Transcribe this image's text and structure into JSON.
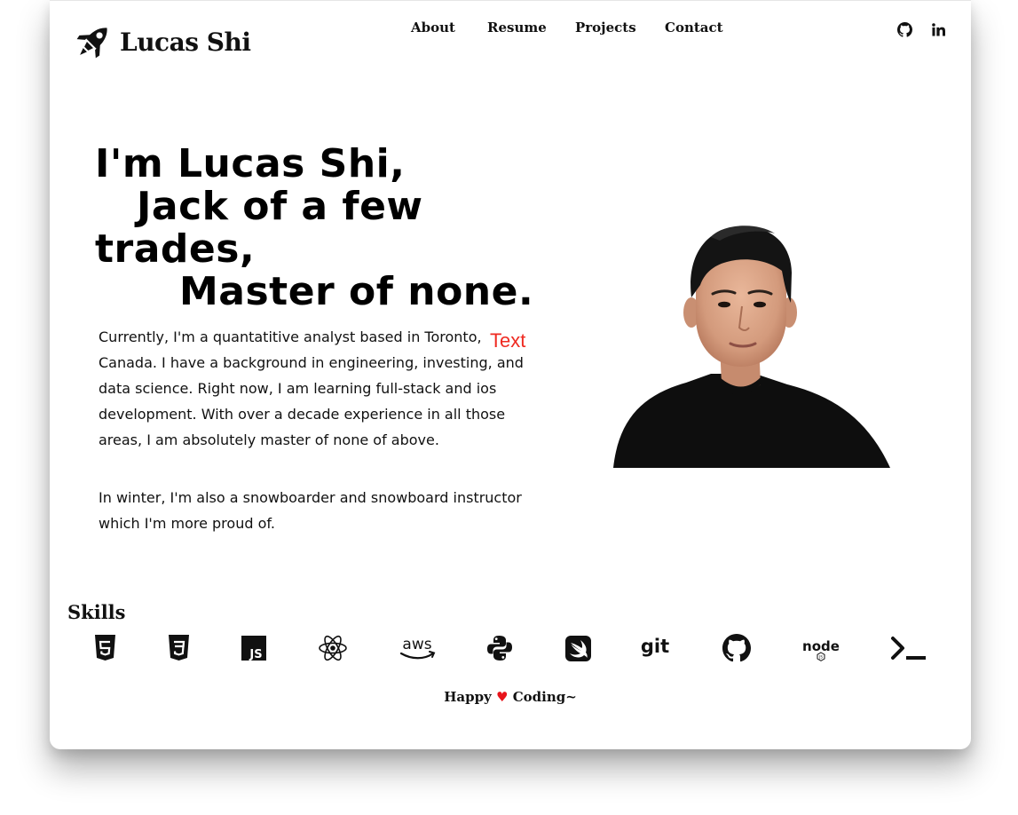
{
  "brand": {
    "name": "Lucas Shi",
    "logo_icon": "rocket-icon"
  },
  "nav": {
    "items": [
      {
        "label": "About"
      },
      {
        "label": "Resume"
      },
      {
        "label": "Projects"
      },
      {
        "label": "Contact"
      }
    ],
    "social": [
      {
        "icon": "github-icon"
      },
      {
        "icon": "linkedin-icon"
      }
    ]
  },
  "hero": {
    "lines": [
      "I'm Lucas Shi,",
      "Jack of a few",
      "trades,",
      "Master of none."
    ],
    "bio_1": "Currently, I'm a quantatitive analyst based in Toronto, Canada. I have a background in engineering, investing, and data science. Right now, I am learning full-stack and ios development. With over a decade experience in all those areas, I am absolutely master of none of above.",
    "bio_2": "In winter, I'm also a snowboarder and snowboard instructor which I'm more proud of.",
    "overlay_text": "Text",
    "overlay_color": "#ef2b22",
    "photo_icon": "portrait-photo"
  },
  "skills": {
    "title": "Skills",
    "icons": [
      "html5-icon",
      "css3-icon",
      "javascript-icon",
      "react-icon",
      "aws-icon",
      "python-icon",
      "swift-icon",
      "git-icon",
      "github-icon",
      "nodejs-icon",
      "terminal-icon"
    ]
  },
  "footer": {
    "prefix": "Happy",
    "heart": "♥",
    "suffix": "Coding~",
    "heart_color": "#e8141b"
  }
}
